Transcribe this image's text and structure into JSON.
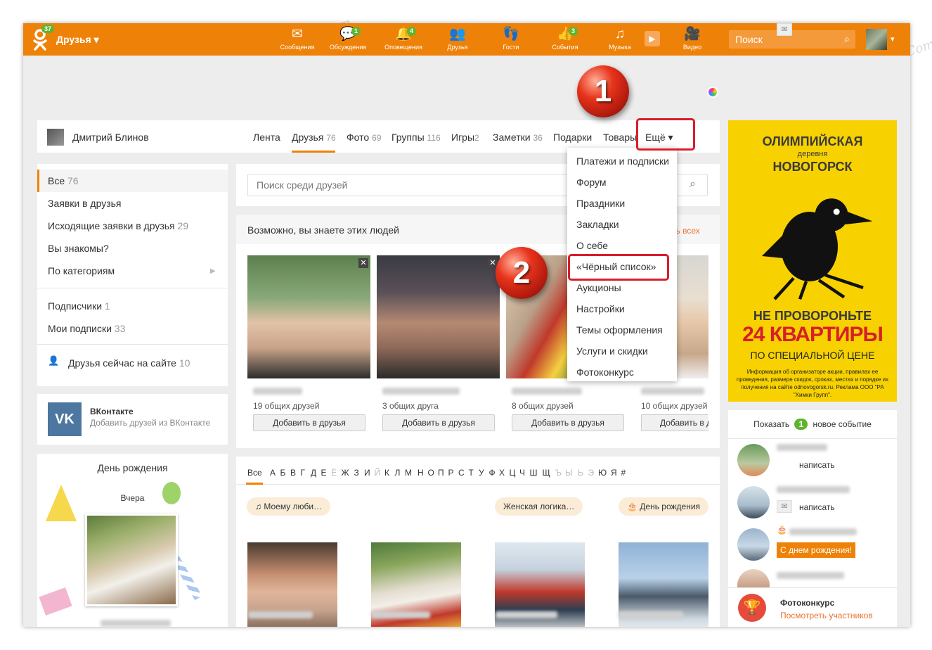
{
  "topbar": {
    "friends_badge": "37",
    "friends_label": "Друзья ▾",
    "nav": [
      {
        "label": "Сообщения",
        "icon": "envelope-icon",
        "badge": ""
      },
      {
        "label": "Обсуждения",
        "icon": "chat-icon",
        "badge": "1"
      },
      {
        "label": "Оповещения",
        "icon": "bell-icon",
        "badge": "4"
      },
      {
        "label": "Друзья",
        "icon": "people-icon",
        "badge": ""
      },
      {
        "label": "Гости",
        "icon": "footprints-icon",
        "badge": ""
      },
      {
        "label": "События",
        "icon": "like-icon",
        "badge": "3"
      },
      {
        "label": "Музыка",
        "icon": "music-icon",
        "badge": ""
      },
      {
        "label": "Видео",
        "icon": "video-icon",
        "badge": ""
      }
    ],
    "search_placeholder": "Поиск",
    "search_icon": "⌕",
    "user_caret": "▾"
  },
  "profile": {
    "name": "Дмитрий Блинов",
    "tabs": [
      {
        "label": "Лента",
        "count": ""
      },
      {
        "label": "Друзья",
        "count": "76"
      },
      {
        "label": "Фото",
        "count": "69"
      },
      {
        "label": "Группы",
        "count": "116"
      },
      {
        "label": "Игры",
        "count": "2"
      },
      {
        "label": "Заметки",
        "count": "36"
      },
      {
        "label": "Подарки",
        "count": ""
      },
      {
        "label": "Товары",
        "count": ""
      },
      {
        "label": "Ещё ▾",
        "count": ""
      }
    ]
  },
  "dropdown": {
    "items": [
      "Платежи и подписки",
      "Форум",
      "Праздники",
      "Закладки",
      "О себе",
      "«Чёрный список»",
      "Аукционы",
      "Настройки",
      "Темы оформления",
      "Услуги и скидки",
      "Фотоконкурс"
    ]
  },
  "annotations": {
    "step1": "1",
    "step2": "2"
  },
  "sidebar": {
    "menu": [
      {
        "label": "Все",
        "count": "76"
      },
      {
        "label": "Заявки в друзья",
        "count": ""
      },
      {
        "label": "Исходящие заявки в друзья",
        "count": "29"
      },
      {
        "label": "Вы знакомы?",
        "count": ""
      },
      {
        "label": "По категориям",
        "count": ""
      }
    ],
    "category_arrow": "▶",
    "subs": [
      {
        "label": "Подписчики",
        "count": "1"
      },
      {
        "label": "Мои подписки",
        "count": "33"
      }
    ],
    "online": {
      "label": "Друзья сейчас на сайте",
      "count": "10"
    },
    "vk": {
      "logo": "VK",
      "title": "ВКонтакте",
      "subtitle": "Добавить друзей из ВКонтакте"
    },
    "birthday": {
      "title": "День рождения",
      "yesterday": "Вчера"
    }
  },
  "main": {
    "search_placeholder": "Поиск среди друзей",
    "suggest_title": "Возможно, вы знаете этих людей",
    "suggest_link": "…ть всех",
    "suggestions": [
      {
        "mutual": "19 общих друзей",
        "button": "Добавить в друзья"
      },
      {
        "mutual": "3 общих друга",
        "button": "Добавить в друзья"
      },
      {
        "mutual": "8 общих друзей",
        "button": "Добавить в друзья"
      },
      {
        "mutual": "10 общих друзей",
        "button": "Добавить в д"
      }
    ],
    "suggest_close": "✕",
    "alphabet": [
      "Все",
      "А",
      "Б",
      "В",
      "Г",
      "Д",
      "Е",
      "Ё",
      "Ж",
      "З",
      "И",
      "Й",
      "К",
      "Л",
      "М",
      "Н",
      "О",
      "П",
      "Р",
      "С",
      "Т",
      "У",
      "Ф",
      "Х",
      "Ц",
      "Ч",
      "Ш",
      "Щ",
      "Ъ",
      "Ы",
      "Ь",
      "Э",
      "Ю",
      "Я",
      "#"
    ],
    "categories": [
      "♫ Моему люби…",
      "Женская логика…",
      "🎂 День рождения"
    ]
  },
  "ad": {
    "headline1": "ОЛИМПИЙСКАЯ",
    "headline2": "деревня",
    "headline3": "НОВОГОРСК",
    "line1": "НЕ ПРОВОРОНЬТЕ",
    "line2": "24 КВАРТИРЫ",
    "line3": "ПО СПЕЦИАЛЬНОЙ ЦЕНЕ",
    "fine": "Информация об организаторе акции, правилах ее проведения, размере скидок, сроках, местах и порядке их получения на сайте odnovogorsk.ru. Реклама ООО \"РА \"Химки Групп\"."
  },
  "feed": {
    "show_label": "Показать",
    "show_count": "1",
    "show_suffix": "новое событие",
    "write": "написать",
    "birthday_btn": "С днем рождения!",
    "contest_title": "Фотоконкурс",
    "contest_link": "Посмотреть участников"
  },
  "watermark": "Soringpcrepair.Com"
}
